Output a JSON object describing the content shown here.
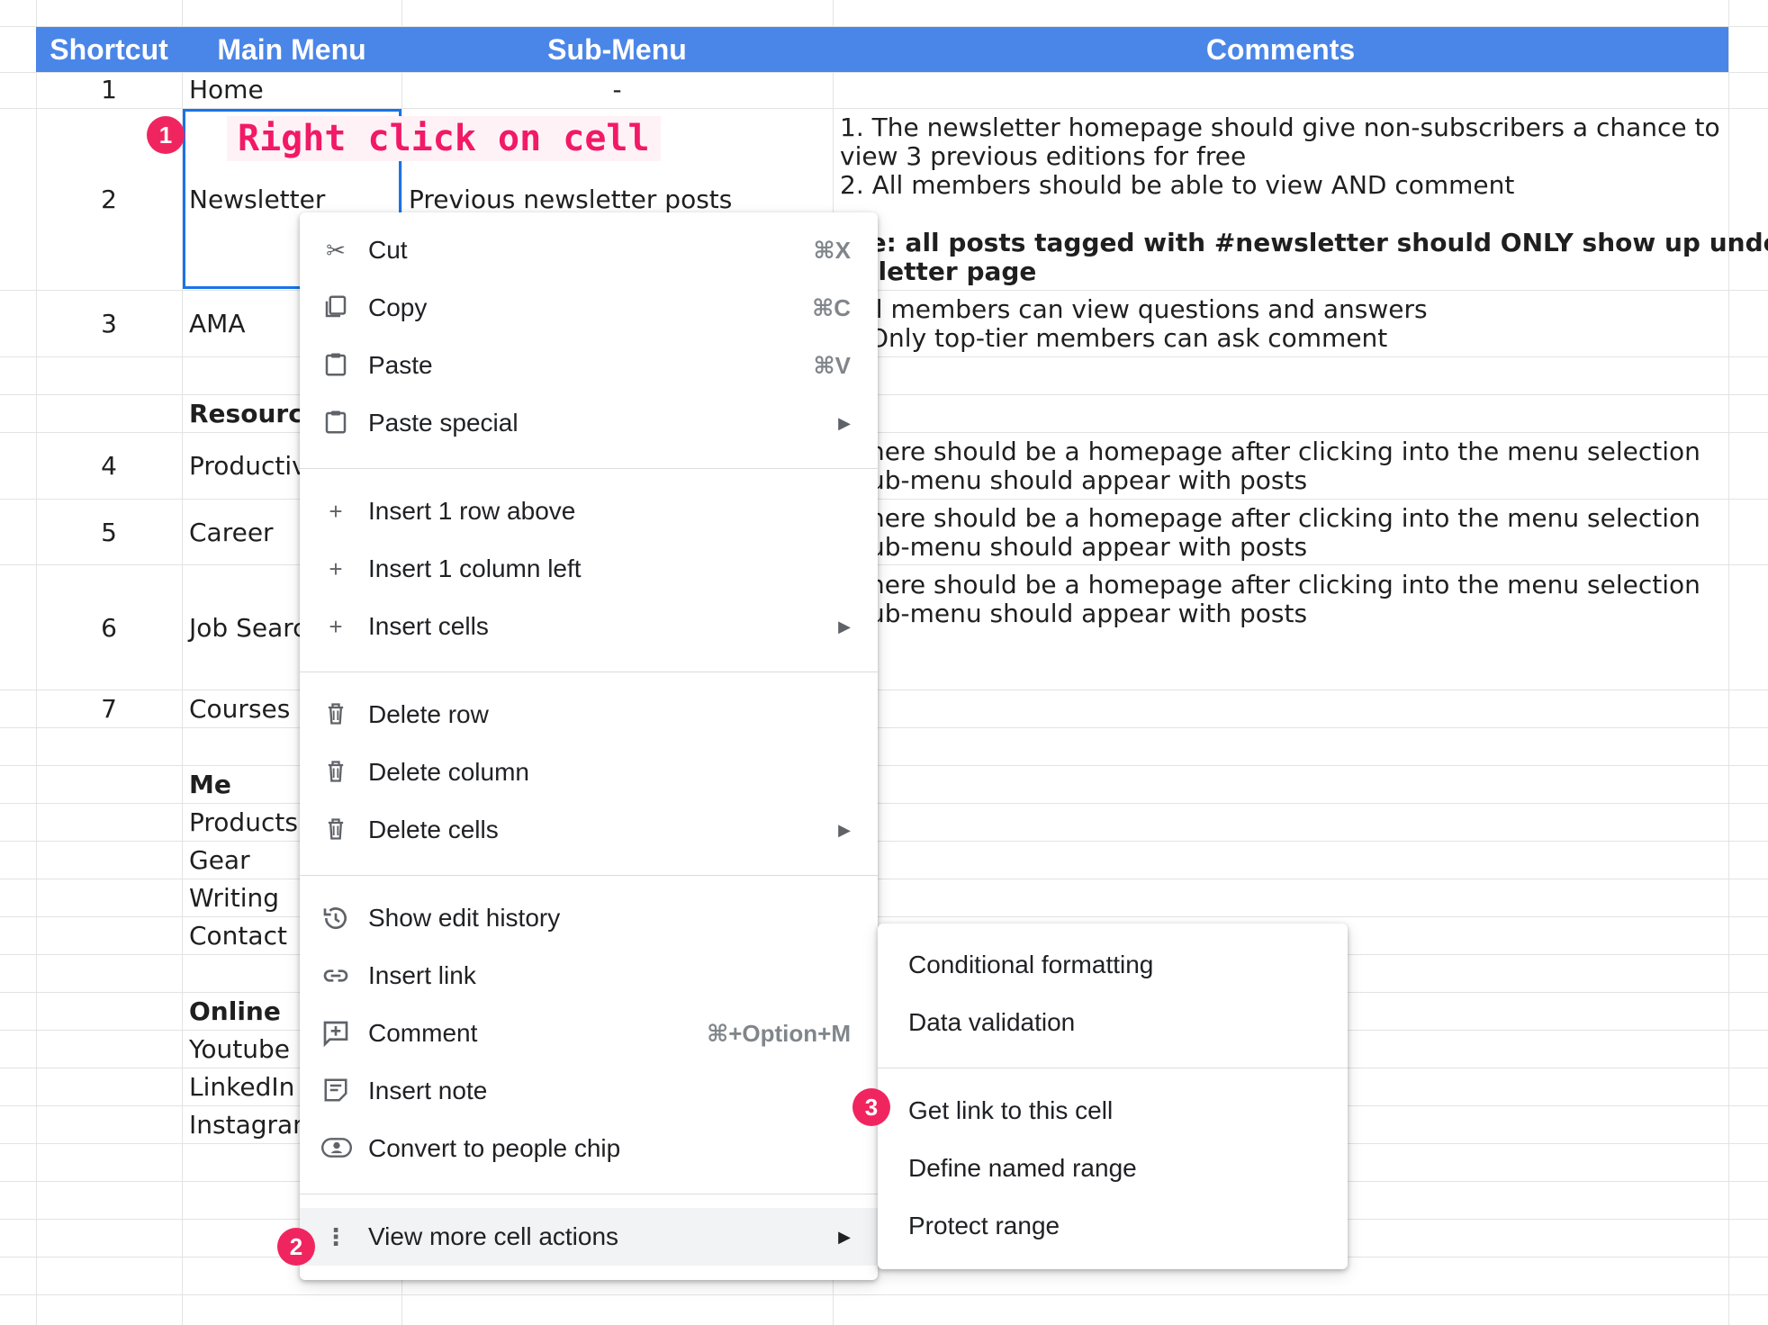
{
  "header": {
    "shortcut": "Shortcut",
    "main_menu": "Main Menu",
    "sub_menu": "Sub-Menu",
    "comments": "Comments"
  },
  "rows": {
    "r1": {
      "num": "1",
      "main": "Home",
      "sub": "-"
    },
    "r2": {
      "num": "2",
      "main": "Newsletter",
      "sub": "Previous newsletter posts",
      "c1": "1. The newsletter homepage should give non-subscribers a chance to",
      "c2": "view 3 previous editions for free",
      "c3": "2. All members should be able to view AND comment",
      "c4": "ote: all posts tagged with #newsletter should ONLY show up under",
      "c5": "wsletter page"
    },
    "r3": {
      "num": "3",
      "main": "AMA",
      "c1": "ll members can view questions and answers",
      "c2": "Only top-tier members can ask comment"
    },
    "resources": "Resource",
    "r4": {
      "num": "4",
      "main": "Productiv",
      "c1": "here should be a homepage after clicking into the menu selection",
      "c2": "ub-menu should appear with posts"
    },
    "r5": {
      "num": "5",
      "main": "Career",
      "c1": "here should be a homepage after clicking into the menu selection",
      "c2": "ub-menu should appear with posts"
    },
    "r6": {
      "num": "6",
      "main": "Job Searc",
      "c1": "here should be a homepage after clicking into the menu selection",
      "c2": "ub-menu should appear with posts"
    },
    "r7": {
      "num": "7",
      "main": "Courses"
    },
    "me": "Me",
    "products": "Products",
    "gear": "Gear",
    "writing": "Writing",
    "contact": "Contact",
    "online": "Online",
    "youtube": "Youtube",
    "linkedin": "LinkedIn",
    "instagram": "Instagran"
  },
  "annotations": {
    "callout": "Right click on cell",
    "badge1": "1",
    "badge2": "2",
    "badge3": "3"
  },
  "context_menu": {
    "cut": {
      "label": "Cut",
      "shortcut": "⌘X",
      "icon": "scissors-icon"
    },
    "copy": {
      "label": "Copy",
      "shortcut": "⌘C",
      "icon": "copy-icon"
    },
    "paste": {
      "label": "Paste",
      "shortcut": "⌘V",
      "icon": "clipboard-icon"
    },
    "paste_special": {
      "label": "Paste special",
      "icon": "clipboard-icon"
    },
    "insert_row": {
      "label": "Insert 1 row above",
      "icon": "plus-icon"
    },
    "insert_col": {
      "label": "Insert 1 column left",
      "icon": "plus-icon"
    },
    "insert_cells": {
      "label": "Insert cells",
      "icon": "plus-icon"
    },
    "delete_row": {
      "label": "Delete row",
      "icon": "trash-icon"
    },
    "delete_col": {
      "label": "Delete column",
      "icon": "trash-icon"
    },
    "delete_cells": {
      "label": "Delete cells",
      "icon": "trash-icon"
    },
    "edit_history": {
      "label": "Show edit history",
      "icon": "history-icon"
    },
    "insert_link": {
      "label": "Insert link",
      "icon": "link-icon"
    },
    "comment": {
      "label": "Comment",
      "shortcut": "⌘+Option+M",
      "icon": "comment-plus-icon"
    },
    "insert_note": {
      "label": "Insert note",
      "icon": "note-icon"
    },
    "people_chip": {
      "label": "Convert to people chip",
      "icon": "person-chip-icon"
    },
    "more_actions": {
      "label": "View more cell actions",
      "icon": "vertical-dots-icon"
    }
  },
  "submenu": {
    "conditional": "Conditional formatting",
    "validation": "Data validation",
    "get_link": "Get link to this cell",
    "named_range": "Define named range",
    "protect": "Protect range"
  },
  "colors": {
    "header_bg": "#4a86e8",
    "selection": "#1a73e8",
    "annotation": "#f0255f"
  }
}
